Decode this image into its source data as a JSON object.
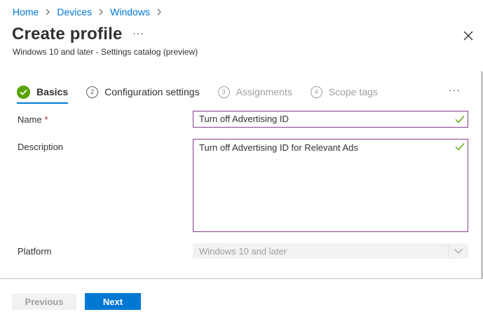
{
  "breadcrumb": [
    "Home",
    "Devices",
    "Windows"
  ],
  "title": "Create profile",
  "title_more": "···",
  "subtitle": "Windows 10 and later - Settings catalog (preview)",
  "steps": [
    {
      "number": "",
      "label": "Basics",
      "state": "completed-active"
    },
    {
      "number": "2",
      "label": "Configuration settings",
      "state": "enabled"
    },
    {
      "number": "3",
      "label": "Assignments",
      "state": "disabled"
    },
    {
      "number": "4",
      "label": "Scope tags",
      "state": "disabled"
    }
  ],
  "steps_more": "···",
  "form": {
    "name_label": "Name",
    "required_marker": "*",
    "name_value": "Turn off Advertising ID",
    "description_label": "Description",
    "description_value": "Turn off Advertising ID for Relevant Ads",
    "platform_label": "Platform",
    "platform_value": "Windows 10 and later"
  },
  "footer": {
    "previous_label": "Previous",
    "next_label": "Next"
  },
  "colors": {
    "accent": "#0078d4",
    "success": "#57a300",
    "input_border": "#8a3a8f",
    "required": "#a4262c"
  },
  "icons": {
    "breadcrumb_separator": "chevron-right-icon",
    "close": "close-icon",
    "step_done": "checkmark-circle-icon",
    "valid": "checkmark-icon",
    "dropdown": "chevron-down-icon"
  }
}
